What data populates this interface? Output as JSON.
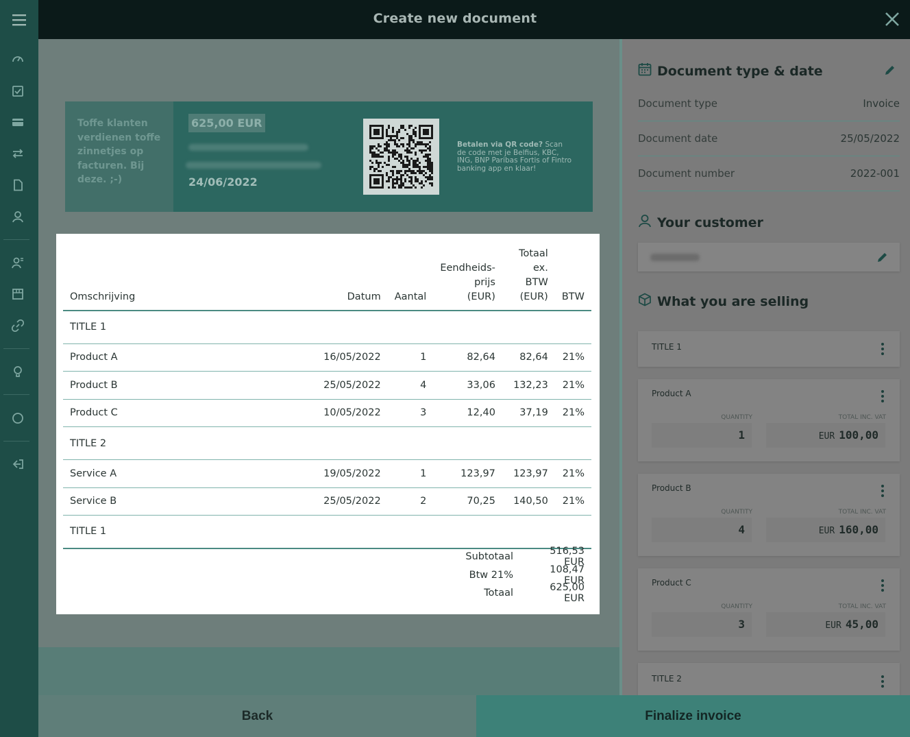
{
  "header": {
    "title": "Create new document"
  },
  "sidebar": {
    "icons": [
      "dashboard-icon",
      "checklist-icon",
      "card-icon",
      "transfer-icon",
      "document-icon",
      "customers-icon",
      "contacts-icon",
      "products-icon",
      "link-icon",
      "lightbulb-icon",
      "circle-icon",
      "logout-icon"
    ]
  },
  "banner": {
    "slogan": "Toffe klanten verdienen toffe zinnetjes op facturen. Bij deze. ;-)",
    "amount": "625,00 EUR",
    "due_date": "24/06/2022",
    "qr_text_bold": "Betalen via QR code?",
    "qr_text": " Scan de code met je Belfius, KBC, ING, BNP Paribas Fortis of Fintro banking app en klaar!"
  },
  "invoice": {
    "headers": {
      "description": "Omschrijving",
      "date": "Datum",
      "qty": "Aantal",
      "unit_1": "Eendheids-",
      "unit_2": "prijs",
      "unit_3": "(EUR)",
      "total_1": "Totaal",
      "total_2": "ex. BTW",
      "total_3": "(EUR)",
      "vat": "BTW"
    },
    "rows": [
      {
        "desc": "TITLE 1"
      },
      {
        "desc": "Product A",
        "date": "16/05/2022",
        "qty": "1",
        "unit": "82,64",
        "total": "82,64",
        "vat": "21%"
      },
      {
        "desc": "Product B",
        "date": "25/05/2022",
        "qty": "4",
        "unit": "33,06",
        "total": "132,23",
        "vat": "21%"
      },
      {
        "desc": "Product C",
        "date": "10/05/2022",
        "qty": "3",
        "unit": "12,40",
        "total": "37,19",
        "vat": "21%"
      },
      {
        "desc": "TITLE 2"
      },
      {
        "desc": "Service A",
        "date": "19/05/2022",
        "qty": "1",
        "unit": "123,97",
        "total": "123,97",
        "vat": "21%"
      },
      {
        "desc": "Service B",
        "date": "25/05/2022",
        "qty": "2",
        "unit": "70,25",
        "total": "140,50",
        "vat": "21%"
      },
      {
        "desc": "TITLE 1"
      }
    ],
    "totals": {
      "subtotal_label": "Subtotaal",
      "subtotal": "516,53 EUR",
      "vat_label": "Btw 21%",
      "vat": "108,47 EUR",
      "total_label": "Totaal",
      "total": "625,00 EUR"
    }
  },
  "panel": {
    "doc_section_title": "Document type & date",
    "doc_type_label": "Document type",
    "doc_type": "Invoice",
    "doc_date_label": "Document date",
    "doc_date": "25/05/2022",
    "doc_number_label": "Document number",
    "doc_number": "2022-001",
    "customer_title": "Your customer",
    "selling_title": "What you are selling",
    "quantity_label": "QUANTITY",
    "total_label": "TOTAL INC. VAT",
    "currency": "EUR",
    "items": [
      {
        "name": "TITLE 1"
      },
      {
        "name": "Product A",
        "qty": "1",
        "total": "100,00"
      },
      {
        "name": "Product B",
        "qty": "4",
        "total": "160,00"
      },
      {
        "name": "Product C",
        "qty": "3",
        "total": "45,00"
      },
      {
        "name": "TITLE 2"
      }
    ]
  },
  "footer": {
    "back": "Back",
    "finalize": "Finalize invoice"
  },
  "colors": {
    "sidebar": "#1e4d47",
    "topbar": "#0b1a19",
    "accent": "#3d8178"
  }
}
